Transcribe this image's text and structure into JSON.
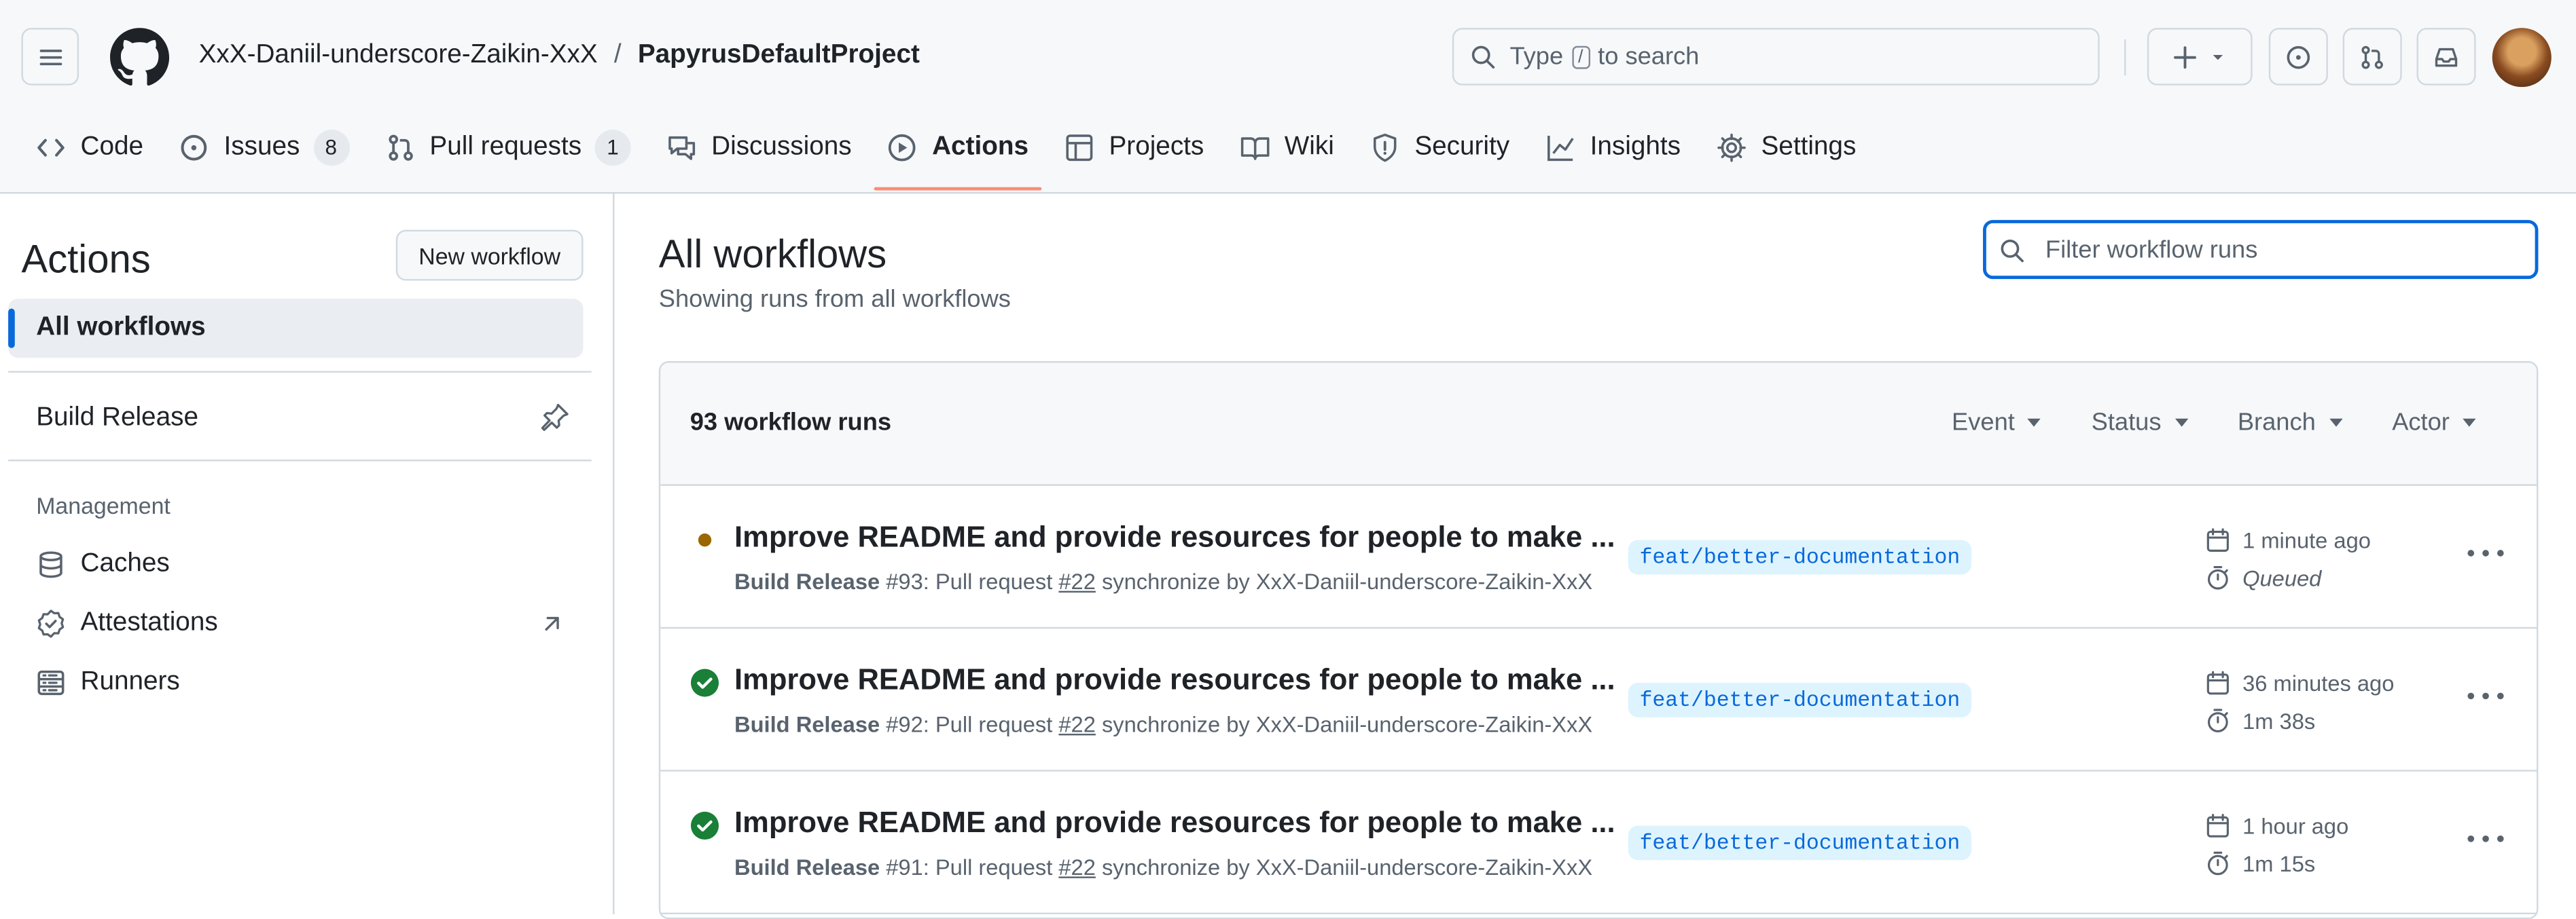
{
  "header": {
    "owner": "XxX-Daniil-underscore-Zaikin-XxX",
    "separator": "/",
    "repo": "PapyrusDefaultProject",
    "search": {
      "prefix": "Type",
      "key": "/",
      "suffix": "to search"
    }
  },
  "tabs": [
    {
      "label": "Code",
      "icon": "code-icon"
    },
    {
      "label": "Issues",
      "icon": "issue-icon",
      "count": "8"
    },
    {
      "label": "Pull requests",
      "icon": "pull-request-icon",
      "count": "1"
    },
    {
      "label": "Discussions",
      "icon": "comment-icon"
    },
    {
      "label": "Actions",
      "icon": "play-icon",
      "selected": true
    },
    {
      "label": "Projects",
      "icon": "table-icon"
    },
    {
      "label": "Wiki",
      "icon": "book-icon"
    },
    {
      "label": "Security",
      "icon": "shield-icon"
    },
    {
      "label": "Insights",
      "icon": "graph-icon"
    },
    {
      "label": "Settings",
      "icon": "gear-icon"
    }
  ],
  "sidebar": {
    "title": "Actions",
    "new_workflow": "New workflow",
    "all_workflows": "All workflows",
    "workflows": [
      {
        "label": "Build Release"
      }
    ],
    "management_label": "Management",
    "management": [
      {
        "label": "Caches",
        "icon": "database-icon"
      },
      {
        "label": "Attestations",
        "icon": "verified-icon"
      },
      {
        "label": "Runners",
        "icon": "server-icon"
      }
    ]
  },
  "main": {
    "title": "All workflows",
    "subtitle": "Showing runs from all workflows",
    "filter_placeholder": "Filter workflow runs",
    "runs_count": "93 workflow runs",
    "filters": [
      "Event",
      "Status",
      "Branch",
      "Actor"
    ],
    "runs": [
      {
        "status": "queued",
        "title": "Improve README and provide resources for people to make ...",
        "workflow": "Build Release",
        "number": "#93",
        "event": ": Pull request ",
        "pr": "#22",
        "action": " synchronize by XxX-Daniil-underscore-Zaikin-XxX",
        "branch": "feat/better-documentation",
        "when": "1 minute ago",
        "duration": "Queued"
      },
      {
        "status": "success",
        "title": "Improve README and provide resources for people to make ...",
        "workflow": "Build Release",
        "number": "#92",
        "event": ": Pull request ",
        "pr": "#22",
        "action": " synchronize by XxX-Daniil-underscore-Zaikin-XxX",
        "branch": "feat/better-documentation",
        "when": "36 minutes ago",
        "duration": "1m 38s"
      },
      {
        "status": "success",
        "title": "Improve README and provide resources for people to make ...",
        "workflow": "Build Release",
        "number": "#91",
        "event": ": Pull request ",
        "pr": "#22",
        "action": " synchronize by XxX-Daniil-underscore-Zaikin-XxX",
        "branch": "feat/better-documentation",
        "when": "1 hour ago",
        "duration": "1m 15s"
      }
    ]
  },
  "colors": {
    "accent": "#0969da",
    "success": "#1a7f37",
    "queued": "#9a6700",
    "tab_underline": "#fd8c73"
  }
}
